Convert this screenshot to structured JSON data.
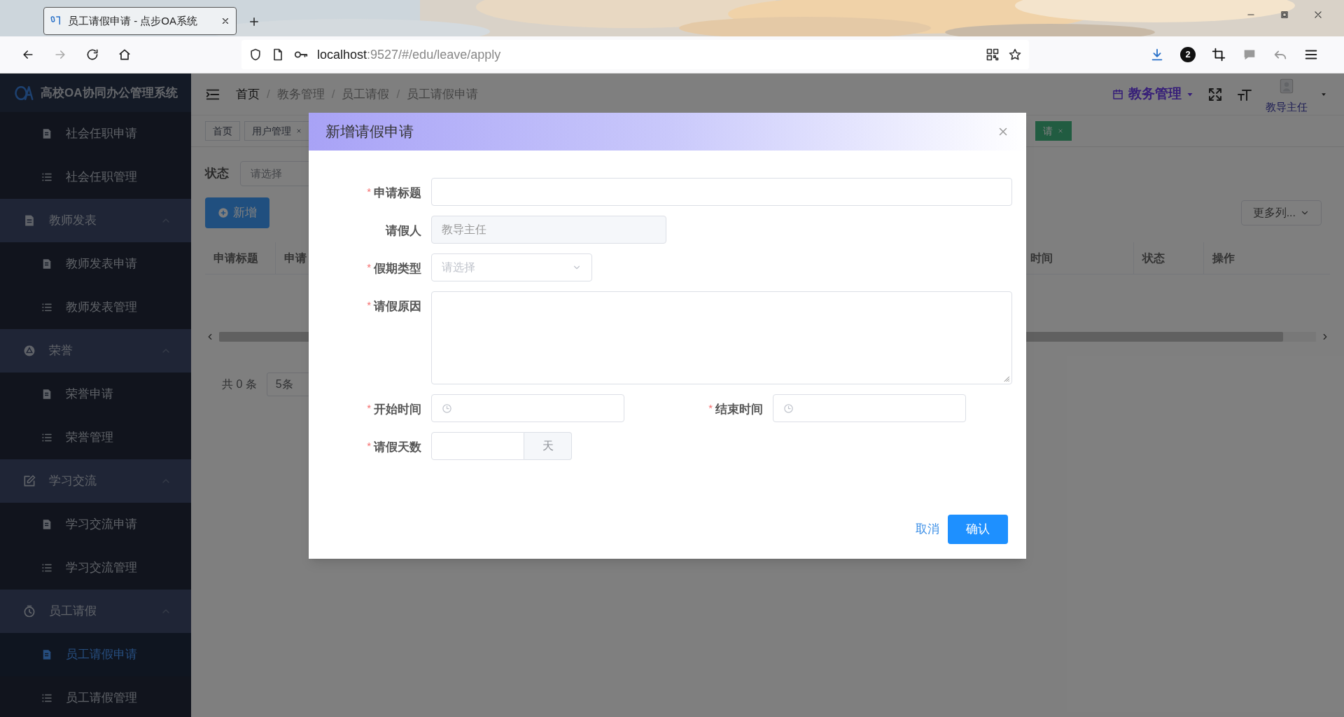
{
  "browser": {
    "tab_title": "员工请假申请 - 点步OA系统",
    "url_host": "localhost",
    "url_rest": ":9527/#/edu/leave/apply",
    "badge": "2"
  },
  "sidebar": {
    "logo": "高校OA协同办公管理系统",
    "items": [
      {
        "kind": "link",
        "label": "社会任职申请",
        "selected": false
      },
      {
        "kind": "link",
        "label": "社会任职管理",
        "selected": false
      },
      {
        "kind": "group",
        "label": "教师发表",
        "expanded": true,
        "children": [
          {
            "kind": "link",
            "label": "教师发表申请",
            "selected": false
          },
          {
            "kind": "link",
            "label": "教师发表管理",
            "selected": false
          }
        ]
      },
      {
        "kind": "group",
        "label": "荣誉",
        "expanded": true,
        "children": [
          {
            "kind": "link",
            "label": "荣誉申请",
            "selected": false
          },
          {
            "kind": "link",
            "label": "荣誉管理",
            "selected": false
          }
        ]
      },
      {
        "kind": "group",
        "label": "学习交流",
        "expanded": true,
        "children": [
          {
            "kind": "link",
            "label": "学习交流申请",
            "selected": false
          },
          {
            "kind": "link",
            "label": "学习交流管理",
            "selected": false
          }
        ]
      },
      {
        "kind": "group",
        "label": "员工请假",
        "expanded": true,
        "children": [
          {
            "kind": "link",
            "label": "员工请假申请",
            "selected": true
          },
          {
            "kind": "link",
            "label": "员工请假管理",
            "selected": false
          }
        ]
      }
    ]
  },
  "header": {
    "breadcrumb": [
      "首页",
      "教务管理",
      "员工请假",
      "员工请假申请"
    ],
    "breadcrumb_separator": "/",
    "system_menu": "教务管理",
    "user": "教导主任"
  },
  "tags": [
    {
      "label": "首页",
      "closable": false,
      "selected": false
    },
    {
      "label": "用户管理",
      "closable": true,
      "selected": false
    },
    {
      "label": "请",
      "closable": true,
      "selected": true
    }
  ],
  "filter": {
    "label": "状态",
    "placeholder": "请选择"
  },
  "toolbar": {
    "add": "新增",
    "more_columns": "更多列..."
  },
  "table": {
    "columns": [
      "申请标题",
      "申请",
      "时间",
      "状态",
      "操作"
    ]
  },
  "pagination": {
    "total": "共 0 条",
    "page_size": "5条"
  },
  "dialog": {
    "title": "新增请假申请",
    "required_mark": "*",
    "rows": [
      [
        {
          "label": "申请标题",
          "required": true,
          "kind": "text"
        }
      ],
      [
        {
          "label": "请假人",
          "required": false,
          "kind": "disabled",
          "value": "教导主任"
        }
      ],
      [
        {
          "label": "假期类型",
          "required": true,
          "kind": "select",
          "placeholder": "请选择"
        }
      ],
      [
        {
          "label": "请假原因",
          "required": true,
          "kind": "textarea"
        }
      ],
      [
        {
          "label": "开始时间",
          "required": true,
          "kind": "time"
        },
        {
          "label": "结束时间",
          "required": true,
          "kind": "time"
        }
      ],
      [
        {
          "label": "请假天数",
          "required": true,
          "kind": "number",
          "append": "天"
        }
      ]
    ],
    "cancel": "取消",
    "confirm": "确认"
  }
}
